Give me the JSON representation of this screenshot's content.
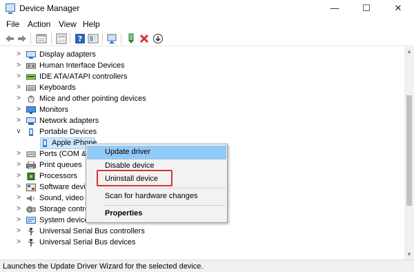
{
  "window": {
    "title": "Device Manager",
    "minimize": "—",
    "maximize": "☐",
    "close": "✕"
  },
  "menu": [
    "File",
    "Action",
    "View",
    "Help"
  ],
  "toolbar": {
    "icons": [
      "back-icon",
      "forward-icon",
      "properties-view-icon",
      "console-tree-icon",
      "help-icon",
      "show-hide-icon",
      "scan-hardware-icon",
      "update-driver-icon",
      "uninstall-icon",
      "enable-device-icon"
    ],
    "uninstall_color": "#d32f2f",
    "update_color": "#2e7d32"
  },
  "tree": {
    "items": [
      {
        "label": "Display adapters",
        "icon": "display-adapter-icon",
        "expanded": false
      },
      {
        "label": "Human Interface Devices",
        "icon": "hid-icon",
        "expanded": false
      },
      {
        "label": "IDE ATA/ATAPI controllers",
        "icon": "ide-icon",
        "expanded": false
      },
      {
        "label": "Keyboards",
        "icon": "keyboard-icon",
        "expanded": false
      },
      {
        "label": "Mice and other pointing devices",
        "icon": "mouse-icon",
        "expanded": false
      },
      {
        "label": "Monitors",
        "icon": "monitor-icon",
        "expanded": false
      },
      {
        "label": "Network adapters",
        "icon": "network-icon",
        "expanded": false
      },
      {
        "label": "Portable Devices",
        "icon": "portable-device-icon",
        "expanded": true
      },
      {
        "label": "Apple iPhone",
        "icon": "phone-icon",
        "child": true,
        "selected": true
      },
      {
        "label": "Ports (COM &",
        "icon": "port-icon",
        "expanded": false
      },
      {
        "label": "Print queues",
        "icon": "printer-icon",
        "expanded": false
      },
      {
        "label": "Processors",
        "icon": "processor-icon",
        "expanded": false
      },
      {
        "label": "Software devic",
        "icon": "software-device-icon",
        "expanded": false
      },
      {
        "label": "Sound, video",
        "icon": "sound-icon",
        "expanded": false
      },
      {
        "label": "Storage contro",
        "icon": "storage-icon",
        "expanded": false
      },
      {
        "label": "System device",
        "icon": "system-device-icon",
        "expanded": false
      },
      {
        "label": "Universal Serial Bus controllers",
        "icon": "usb-icon",
        "expanded": false
      },
      {
        "label": "Universal Serial Bus devices",
        "icon": "usb-icon",
        "expanded": false
      }
    ]
  },
  "context_menu": {
    "items": [
      "Update driver",
      "Disable device",
      "Uninstall device",
      "Scan for hardware changes",
      "Properties"
    ],
    "highlighted": "Update driver",
    "emphasized": "Uninstall device",
    "emphasis_color": "#d73232"
  },
  "status": {
    "text": "Launches the Update Driver Wizard for the selected device."
  }
}
